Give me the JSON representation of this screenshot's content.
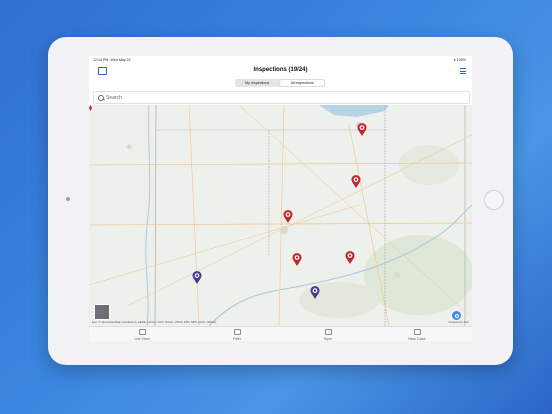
{
  "status": {
    "time": "12:14 PM",
    "date": "Wed May 22",
    "battery": "100%"
  },
  "header": {
    "title": "Inspections (19/24)"
  },
  "segments": [
    {
      "label": "My Inspections",
      "selected": false
    },
    {
      "label": "All Inspections",
      "selected": true
    }
  ],
  "search": {
    "placeholder": "Search",
    "value": ""
  },
  "map": {
    "attribution": "Esri, © OpenStreetMap contributors, HERE, Garmin, FAO, NOAA, USGS, EPA, NPS, AAFC, NRCan",
    "powered_by": "Powered by Esri",
    "pins": [
      {
        "status": "red",
        "icon": "inspection-pin-icon"
      },
      {
        "status": "red",
        "icon": "inspection-pin-icon"
      },
      {
        "status": "red",
        "icon": "inspection-pin-icon"
      },
      {
        "status": "red",
        "icon": "inspection-pin-icon"
      },
      {
        "status": "red",
        "icon": "inspection-pin-icon"
      },
      {
        "status": "purple",
        "icon": "inspection-pin-icon"
      },
      {
        "status": "purple",
        "icon": "inspection-pin-icon"
      }
    ]
  },
  "tabbar": {
    "items": [
      {
        "label": "List View",
        "icon": "list-icon"
      },
      {
        "label": "Filter",
        "icon": "filter-icon"
      },
      {
        "label": "Sync",
        "icon": "sync-icon"
      },
      {
        "label": "New Case",
        "icon": "plus-icon"
      }
    ]
  },
  "colors": {
    "accent": "#2b64d4",
    "pin_red": "#c0262d",
    "pin_purple": "#4b3a8f"
  }
}
